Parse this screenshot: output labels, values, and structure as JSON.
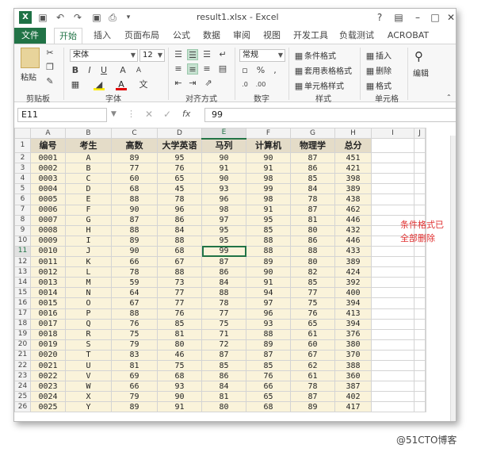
{
  "window": {
    "title": "result1.xlsx - Excel",
    "help": "?",
    "app_icon": "X"
  },
  "tabs": [
    "文件",
    "开始",
    "插入",
    "页面布局",
    "公式",
    "数据",
    "审阅",
    "视图",
    "开发工具",
    "负载测试",
    "ACROBAT"
  ],
  "ribbon": {
    "clipboard": {
      "label": "剪贴板",
      "paste": "粘贴"
    },
    "font": {
      "label": "字体",
      "name": "宋体",
      "size": "12"
    },
    "alignment": {
      "label": "对齐方式"
    },
    "number": {
      "label": "数字",
      "format": "常规"
    },
    "styles": {
      "label": "样式",
      "conditional": "条件格式",
      "table": "套用表格格式",
      "cell": "单元格样式"
    },
    "cells": {
      "label": "单元格",
      "insert": "插入",
      "delete": "删除",
      "format": "格式"
    },
    "editing": {
      "label": "编辑"
    }
  },
  "formula_bar": {
    "name_box": "E11",
    "fx": "fx",
    "value": "99"
  },
  "columns": [
    "A",
    "B",
    "C",
    "D",
    "E",
    "F",
    "G",
    "H",
    "I",
    "J"
  ],
  "headers": [
    "编号",
    "考生",
    "高数",
    "大学英语",
    "马列",
    "计算机",
    "物理学",
    "总分"
  ],
  "rows": [
    [
      "0001",
      "A",
      "89",
      "95",
      "90",
      "90",
      "87",
      "451"
    ],
    [
      "0002",
      "B",
      "77",
      "76",
      "91",
      "91",
      "86",
      "421"
    ],
    [
      "0003",
      "C",
      "60",
      "65",
      "90",
      "98",
      "85",
      "398"
    ],
    [
      "0004",
      "D",
      "68",
      "45",
      "93",
      "99",
      "84",
      "389"
    ],
    [
      "0005",
      "E",
      "88",
      "78",
      "96",
      "98",
      "78",
      "438"
    ],
    [
      "0006",
      "F",
      "90",
      "96",
      "98",
      "91",
      "87",
      "462"
    ],
    [
      "0007",
      "G",
      "87",
      "86",
      "97",
      "95",
      "81",
      "446"
    ],
    [
      "0008",
      "H",
      "88",
      "84",
      "95",
      "85",
      "80",
      "432"
    ],
    [
      "0009",
      "I",
      "89",
      "88",
      "95",
      "88",
      "86",
      "446"
    ],
    [
      "0010",
      "J",
      "90",
      "68",
      "99",
      "88",
      "88",
      "433"
    ],
    [
      "0011",
      "K",
      "66",
      "67",
      "87",
      "89",
      "80",
      "389"
    ],
    [
      "0012",
      "L",
      "78",
      "88",
      "86",
      "90",
      "82",
      "424"
    ],
    [
      "0013",
      "M",
      "59",
      "73",
      "84",
      "91",
      "85",
      "392"
    ],
    [
      "0014",
      "N",
      "64",
      "77",
      "88",
      "94",
      "77",
      "400"
    ],
    [
      "0015",
      "O",
      "67",
      "77",
      "78",
      "97",
      "75",
      "394"
    ],
    [
      "0016",
      "P",
      "88",
      "76",
      "77",
      "96",
      "76",
      "413"
    ],
    [
      "0017",
      "Q",
      "76",
      "85",
      "75",
      "93",
      "65",
      "394"
    ],
    [
      "0018",
      "R",
      "75",
      "81",
      "71",
      "88",
      "61",
      "376"
    ],
    [
      "0019",
      "S",
      "79",
      "80",
      "72",
      "89",
      "60",
      "380"
    ],
    [
      "0020",
      "T",
      "83",
      "46",
      "87",
      "87",
      "67",
      "370"
    ],
    [
      "0021",
      "U",
      "81",
      "75",
      "85",
      "85",
      "62",
      "388"
    ],
    [
      "0022",
      "V",
      "69",
      "68",
      "86",
      "76",
      "61",
      "360"
    ],
    [
      "0023",
      "W",
      "66",
      "93",
      "84",
      "66",
      "78",
      "387"
    ],
    [
      "0024",
      "X",
      "79",
      "90",
      "81",
      "65",
      "87",
      "402"
    ],
    [
      "0025",
      "Y",
      "89",
      "91",
      "80",
      "68",
      "89",
      "417"
    ]
  ],
  "row_numbers": [
    "1",
    "2",
    "3",
    "4",
    "5",
    "6",
    "7",
    "8",
    "9",
    "10",
    "11",
    "12",
    "13",
    "14",
    "15",
    "16",
    "17",
    "18",
    "19",
    "20",
    "21",
    "22",
    "23",
    "24",
    "25",
    "26"
  ],
  "note": [
    "条件格式已",
    "全部删除"
  ],
  "watermark": "@51CTO博客",
  "colors": {
    "excel_green": "#217346",
    "header_fill": "#e4dcc8",
    "data_fill": "#faf3da",
    "note_red": "#e03030"
  }
}
